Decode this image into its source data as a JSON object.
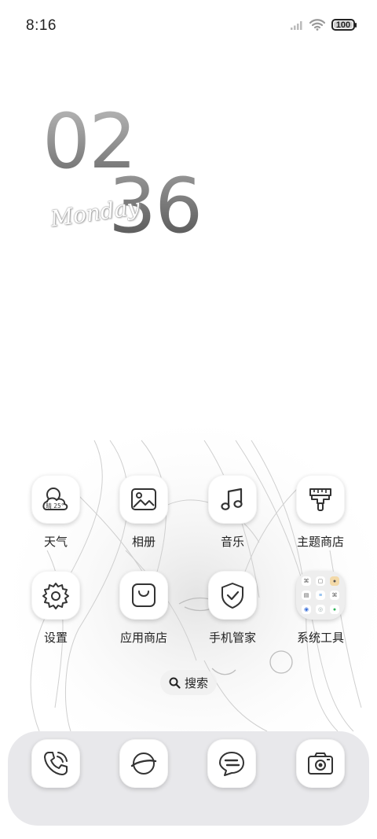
{
  "status_bar": {
    "time": "8:16",
    "battery_level": "100",
    "signal_icon": "signal-bars-icon",
    "wifi_icon": "wifi-icon"
  },
  "clock_widget": {
    "hours": "02",
    "minutes": "36",
    "weekday": "Monday"
  },
  "apps": [
    {
      "label": "天气",
      "icon": "weather-icon",
      "weather_text": "晴 25°"
    },
    {
      "label": "相册",
      "icon": "gallery-icon"
    },
    {
      "label": "音乐",
      "icon": "music-icon"
    },
    {
      "label": "主题商店",
      "icon": "theme-brush-icon"
    },
    {
      "label": "设置",
      "icon": "gear-icon"
    },
    {
      "label": "应用商店",
      "icon": "shopping-bag-icon"
    },
    {
      "label": "手机管家",
      "icon": "shield-check-icon"
    },
    {
      "label": "系统工具",
      "icon": "folder-icon"
    }
  ],
  "search": {
    "label": "搜索",
    "icon": "search-icon"
  },
  "dock": [
    {
      "name": "phone",
      "icon": "phone-icon"
    },
    {
      "name": "browser",
      "icon": "browser-globe-icon"
    },
    {
      "name": "messages",
      "icon": "message-bubble-icon"
    },
    {
      "name": "camera",
      "icon": "camera-icon"
    }
  ],
  "colors": {
    "background": "#ffffff",
    "text": "#222222",
    "icon_stroke": "#333333",
    "dock": "#e6e6e9"
  }
}
